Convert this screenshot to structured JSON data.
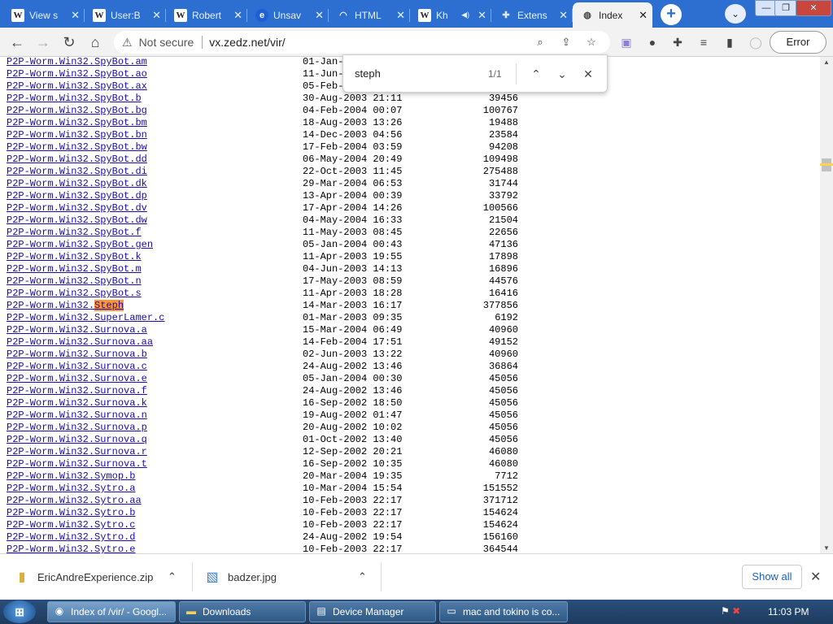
{
  "tabs": [
    {
      "icon": "wikipedia-icon",
      "title": "View s",
      "active": false
    },
    {
      "icon": "wikipedia-icon",
      "title": "User:B",
      "active": false
    },
    {
      "icon": "wikipedia-icon",
      "title": "Robert",
      "active": false
    },
    {
      "icon": "edge-icon",
      "title": "Unsav",
      "active": false
    },
    {
      "icon": "html-icon",
      "title": "HTML",
      "active": false
    },
    {
      "icon": "wikipedia-icon",
      "title": "Kh",
      "active": false
    },
    {
      "icon": "puzzle-icon",
      "title": "Extens",
      "active": false
    },
    {
      "icon": "globe-icon",
      "title": "Index",
      "active": true
    }
  ],
  "window": {
    "minimize": "—",
    "restore": "❐",
    "close": "✕"
  },
  "toolbar": {
    "security_label": "Not secure",
    "url": "vx.zedz.net/vir/",
    "error_label": "Error"
  },
  "find": {
    "query": "steph",
    "count": "1/1",
    "highlight": "#ff9632"
  },
  "rows": [
    {
      "prefix": "P2P-Worm.Win32.",
      "suffix": "SpyBot.am",
      "date": "01-Jan-",
      "size": ""
    },
    {
      "prefix": "P2P-Worm.Win32.",
      "suffix": "SpyBot.ao",
      "date": "11-Jun-",
      "size": ""
    },
    {
      "prefix": "P2P-Worm.Win32.",
      "suffix": "SpyBot.ax",
      "date": "05-Feb-",
      "size": ""
    },
    {
      "prefix": "P2P-Worm.Win32.",
      "suffix": "SpyBot.b",
      "date": "30-Aug-2003 21:11",
      "size": "39456"
    },
    {
      "prefix": "P2P-Worm.Win32.",
      "suffix": "SpyBot.bg",
      "date": "04-Feb-2004 00:07",
      "size": "100767"
    },
    {
      "prefix": "P2P-Worm.Win32.",
      "suffix": "SpyBot.bm",
      "date": "18-Aug-2003 13:26",
      "size": "19488"
    },
    {
      "prefix": "P2P-Worm.Win32.",
      "suffix": "SpyBot.bn",
      "date": "14-Dec-2003 04:56",
      "size": "23584"
    },
    {
      "prefix": "P2P-Worm.Win32.",
      "suffix": "SpyBot.bw",
      "date": "17-Feb-2004 03:59",
      "size": "94208"
    },
    {
      "prefix": "P2P-Worm.Win32.",
      "suffix": "SpyBot.dd",
      "date": "06-May-2004 20:49",
      "size": "109498"
    },
    {
      "prefix": "P2P-Worm.Win32.",
      "suffix": "SpyBot.di",
      "date": "22-Oct-2003 11:45",
      "size": "275488"
    },
    {
      "prefix": "P2P-Worm.Win32.",
      "suffix": "SpyBot.dk",
      "date": "29-Mar-2004 06:53",
      "size": "31744"
    },
    {
      "prefix": "P2P-Worm.Win32.",
      "suffix": "SpyBot.dp",
      "date": "13-Apr-2004 00:39",
      "size": "33792"
    },
    {
      "prefix": "P2P-Worm.Win32.",
      "suffix": "SpyBot.dv",
      "date": "17-Apr-2004 14:26",
      "size": "100566"
    },
    {
      "prefix": "P2P-Worm.Win32.",
      "suffix": "SpyBot.dw",
      "date": "04-May-2004 16:33",
      "size": "21504"
    },
    {
      "prefix": "P2P-Worm.Win32.",
      "suffix": "SpyBot.f",
      "date": "11-May-2003 08:45",
      "size": "22656"
    },
    {
      "prefix": "P2P-Worm.Win32.",
      "suffix": "SpyBot.gen",
      "date": "05-Jan-2004 00:43",
      "size": "47136"
    },
    {
      "prefix": "P2P-Worm.Win32.",
      "suffix": "SpyBot.k",
      "date": "11-Apr-2003 19:55",
      "size": "17898"
    },
    {
      "prefix": "P2P-Worm.Win32.",
      "suffix": "SpyBot.m",
      "date": "04-Jun-2003 14:13",
      "size": "16896"
    },
    {
      "prefix": "P2P-Worm.Win32.",
      "suffix": "SpyBot.n",
      "date": "17-May-2003 08:59",
      "size": "44576"
    },
    {
      "prefix": "P2P-Worm.Win32.",
      "suffix": "SpyBot.s",
      "date": "11-Apr-2003 18:28",
      "size": "16416"
    },
    {
      "prefix": "P2P-Worm.Win32.",
      "suffix": "Steph",
      "date": "14-Mar-2003 16:17",
      "size": "377856",
      "highlight": true
    },
    {
      "prefix": "P2P-Worm.Win32.",
      "suffix": "SuperLamer.c",
      "date": "01-Mar-2003 09:35",
      "size": "6192"
    },
    {
      "prefix": "P2P-Worm.Win32.",
      "suffix": "Surnova.a",
      "date": "15-Mar-2004 06:49",
      "size": "40960"
    },
    {
      "prefix": "P2P-Worm.Win32.",
      "suffix": "Surnova.aa",
      "date": "14-Feb-2004 17:51",
      "size": "49152"
    },
    {
      "prefix": "P2P-Worm.Win32.",
      "suffix": "Surnova.b",
      "date": "02-Jun-2003 13:22",
      "size": "40960"
    },
    {
      "prefix": "P2P-Worm.Win32.",
      "suffix": "Surnova.c",
      "date": "24-Aug-2002 13:46",
      "size": "36864"
    },
    {
      "prefix": "P2P-Worm.Win32.",
      "suffix": "Surnova.e",
      "date": "05-Jan-2004 00:30",
      "size": "45056"
    },
    {
      "prefix": "P2P-Worm.Win32.",
      "suffix": "Surnova.f",
      "date": "24-Aug-2002 13:46",
      "size": "45056"
    },
    {
      "prefix": "P2P-Worm.Win32.",
      "suffix": "Surnova.k",
      "date": "16-Sep-2002 18:50",
      "size": "45056"
    },
    {
      "prefix": "P2P-Worm.Win32.",
      "suffix": "Surnova.n",
      "date": "19-Aug-2002 01:47",
      "size": "45056"
    },
    {
      "prefix": "P2P-Worm.Win32.",
      "suffix": "Surnova.p",
      "date": "20-Aug-2002 10:02",
      "size": "45056"
    },
    {
      "prefix": "P2P-Worm.Win32.",
      "suffix": "Surnova.q",
      "date": "01-Oct-2002 13:40",
      "size": "45056"
    },
    {
      "prefix": "P2P-Worm.Win32.",
      "suffix": "Surnova.r",
      "date": "12-Sep-2002 20:21",
      "size": "46080"
    },
    {
      "prefix": "P2P-Worm.Win32.",
      "suffix": "Surnova.t",
      "date": "16-Sep-2002 10:35",
      "size": "46080"
    },
    {
      "prefix": "P2P-Worm.Win32.",
      "suffix": "Symop.b",
      "date": "20-Mar-2004 19:35",
      "size": "7712"
    },
    {
      "prefix": "P2P-Worm.Win32.",
      "suffix": "Sytro.a",
      "date": "10-Mar-2004 15:54",
      "size": "151552"
    },
    {
      "prefix": "P2P-Worm.Win32.",
      "suffix": "Sytro.aa",
      "date": "10-Feb-2003 22:17",
      "size": "371712"
    },
    {
      "prefix": "P2P-Worm.Win32.",
      "suffix": "Sytro.b",
      "date": "10-Feb-2003 22:17",
      "size": "154624"
    },
    {
      "prefix": "P2P-Worm.Win32.",
      "suffix": "Sytro.c",
      "date": "10-Feb-2003 22:17",
      "size": "154624"
    },
    {
      "prefix": "P2P-Worm.Win32.",
      "suffix": "Sytro.d",
      "date": "24-Aug-2002 19:54",
      "size": "156160"
    },
    {
      "prefix": "P2P-Worm.Win32.",
      "suffix": "Sytro.e",
      "date": "10-Feb-2003 22:17",
      "size": "364544"
    }
  ],
  "downloads": {
    "items": [
      {
        "icon": "zip-file-icon",
        "name": "EricAndreExperience.zip"
      },
      {
        "icon": "image-file-icon",
        "name": "badzer.jpg"
      }
    ],
    "show_all": "Show all"
  },
  "taskbar": {
    "items": [
      {
        "icon": "chrome-icon",
        "label": "Index of /vir/ - Googl...",
        "active": true
      },
      {
        "icon": "folder-icon",
        "label": "Downloads",
        "active": false
      },
      {
        "icon": "device-manager-icon",
        "label": "Device Manager",
        "active": false
      },
      {
        "icon": "document-icon",
        "label": "mac and tokino is co...",
        "active": false
      }
    ],
    "clock": "11:03 PM"
  }
}
